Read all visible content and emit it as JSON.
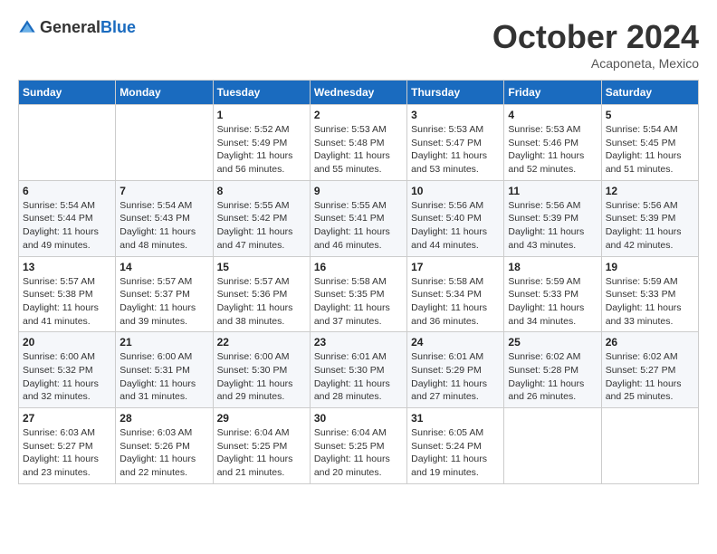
{
  "logo": {
    "general": "General",
    "blue": "Blue"
  },
  "header": {
    "month": "October 2024",
    "location": "Acaponeta, Mexico"
  },
  "weekdays": [
    "Sunday",
    "Monday",
    "Tuesday",
    "Wednesday",
    "Thursday",
    "Friday",
    "Saturday"
  ],
  "weeks": [
    [
      {
        "day": "",
        "sunrise": "",
        "sunset": "",
        "daylight": ""
      },
      {
        "day": "",
        "sunrise": "",
        "sunset": "",
        "daylight": ""
      },
      {
        "day": "1",
        "sunrise": "Sunrise: 5:52 AM",
        "sunset": "Sunset: 5:49 PM",
        "daylight": "Daylight: 11 hours and 56 minutes."
      },
      {
        "day": "2",
        "sunrise": "Sunrise: 5:53 AM",
        "sunset": "Sunset: 5:48 PM",
        "daylight": "Daylight: 11 hours and 55 minutes."
      },
      {
        "day": "3",
        "sunrise": "Sunrise: 5:53 AM",
        "sunset": "Sunset: 5:47 PM",
        "daylight": "Daylight: 11 hours and 53 minutes."
      },
      {
        "day": "4",
        "sunrise": "Sunrise: 5:53 AM",
        "sunset": "Sunset: 5:46 PM",
        "daylight": "Daylight: 11 hours and 52 minutes."
      },
      {
        "day": "5",
        "sunrise": "Sunrise: 5:54 AM",
        "sunset": "Sunset: 5:45 PM",
        "daylight": "Daylight: 11 hours and 51 minutes."
      }
    ],
    [
      {
        "day": "6",
        "sunrise": "Sunrise: 5:54 AM",
        "sunset": "Sunset: 5:44 PM",
        "daylight": "Daylight: 11 hours and 49 minutes."
      },
      {
        "day": "7",
        "sunrise": "Sunrise: 5:54 AM",
        "sunset": "Sunset: 5:43 PM",
        "daylight": "Daylight: 11 hours and 48 minutes."
      },
      {
        "day": "8",
        "sunrise": "Sunrise: 5:55 AM",
        "sunset": "Sunset: 5:42 PM",
        "daylight": "Daylight: 11 hours and 47 minutes."
      },
      {
        "day": "9",
        "sunrise": "Sunrise: 5:55 AM",
        "sunset": "Sunset: 5:41 PM",
        "daylight": "Daylight: 11 hours and 46 minutes."
      },
      {
        "day": "10",
        "sunrise": "Sunrise: 5:56 AM",
        "sunset": "Sunset: 5:40 PM",
        "daylight": "Daylight: 11 hours and 44 minutes."
      },
      {
        "day": "11",
        "sunrise": "Sunrise: 5:56 AM",
        "sunset": "Sunset: 5:39 PM",
        "daylight": "Daylight: 11 hours and 43 minutes."
      },
      {
        "day": "12",
        "sunrise": "Sunrise: 5:56 AM",
        "sunset": "Sunset: 5:39 PM",
        "daylight": "Daylight: 11 hours and 42 minutes."
      }
    ],
    [
      {
        "day": "13",
        "sunrise": "Sunrise: 5:57 AM",
        "sunset": "Sunset: 5:38 PM",
        "daylight": "Daylight: 11 hours and 41 minutes."
      },
      {
        "day": "14",
        "sunrise": "Sunrise: 5:57 AM",
        "sunset": "Sunset: 5:37 PM",
        "daylight": "Daylight: 11 hours and 39 minutes."
      },
      {
        "day": "15",
        "sunrise": "Sunrise: 5:57 AM",
        "sunset": "Sunset: 5:36 PM",
        "daylight": "Daylight: 11 hours and 38 minutes."
      },
      {
        "day": "16",
        "sunrise": "Sunrise: 5:58 AM",
        "sunset": "Sunset: 5:35 PM",
        "daylight": "Daylight: 11 hours and 37 minutes."
      },
      {
        "day": "17",
        "sunrise": "Sunrise: 5:58 AM",
        "sunset": "Sunset: 5:34 PM",
        "daylight": "Daylight: 11 hours and 36 minutes."
      },
      {
        "day": "18",
        "sunrise": "Sunrise: 5:59 AM",
        "sunset": "Sunset: 5:33 PM",
        "daylight": "Daylight: 11 hours and 34 minutes."
      },
      {
        "day": "19",
        "sunrise": "Sunrise: 5:59 AM",
        "sunset": "Sunset: 5:33 PM",
        "daylight": "Daylight: 11 hours and 33 minutes."
      }
    ],
    [
      {
        "day": "20",
        "sunrise": "Sunrise: 6:00 AM",
        "sunset": "Sunset: 5:32 PM",
        "daylight": "Daylight: 11 hours and 32 minutes."
      },
      {
        "day": "21",
        "sunrise": "Sunrise: 6:00 AM",
        "sunset": "Sunset: 5:31 PM",
        "daylight": "Daylight: 11 hours and 31 minutes."
      },
      {
        "day": "22",
        "sunrise": "Sunrise: 6:00 AM",
        "sunset": "Sunset: 5:30 PM",
        "daylight": "Daylight: 11 hours and 29 minutes."
      },
      {
        "day": "23",
        "sunrise": "Sunrise: 6:01 AM",
        "sunset": "Sunset: 5:30 PM",
        "daylight": "Daylight: 11 hours and 28 minutes."
      },
      {
        "day": "24",
        "sunrise": "Sunrise: 6:01 AM",
        "sunset": "Sunset: 5:29 PM",
        "daylight": "Daylight: 11 hours and 27 minutes."
      },
      {
        "day": "25",
        "sunrise": "Sunrise: 6:02 AM",
        "sunset": "Sunset: 5:28 PM",
        "daylight": "Daylight: 11 hours and 26 minutes."
      },
      {
        "day": "26",
        "sunrise": "Sunrise: 6:02 AM",
        "sunset": "Sunset: 5:27 PM",
        "daylight": "Daylight: 11 hours and 25 minutes."
      }
    ],
    [
      {
        "day": "27",
        "sunrise": "Sunrise: 6:03 AM",
        "sunset": "Sunset: 5:27 PM",
        "daylight": "Daylight: 11 hours and 23 minutes."
      },
      {
        "day": "28",
        "sunrise": "Sunrise: 6:03 AM",
        "sunset": "Sunset: 5:26 PM",
        "daylight": "Daylight: 11 hours and 22 minutes."
      },
      {
        "day": "29",
        "sunrise": "Sunrise: 6:04 AM",
        "sunset": "Sunset: 5:25 PM",
        "daylight": "Daylight: 11 hours and 21 minutes."
      },
      {
        "day": "30",
        "sunrise": "Sunrise: 6:04 AM",
        "sunset": "Sunset: 5:25 PM",
        "daylight": "Daylight: 11 hours and 20 minutes."
      },
      {
        "day": "31",
        "sunrise": "Sunrise: 6:05 AM",
        "sunset": "Sunset: 5:24 PM",
        "daylight": "Daylight: 11 hours and 19 minutes."
      },
      {
        "day": "",
        "sunrise": "",
        "sunset": "",
        "daylight": ""
      },
      {
        "day": "",
        "sunrise": "",
        "sunset": "",
        "daylight": ""
      }
    ]
  ]
}
